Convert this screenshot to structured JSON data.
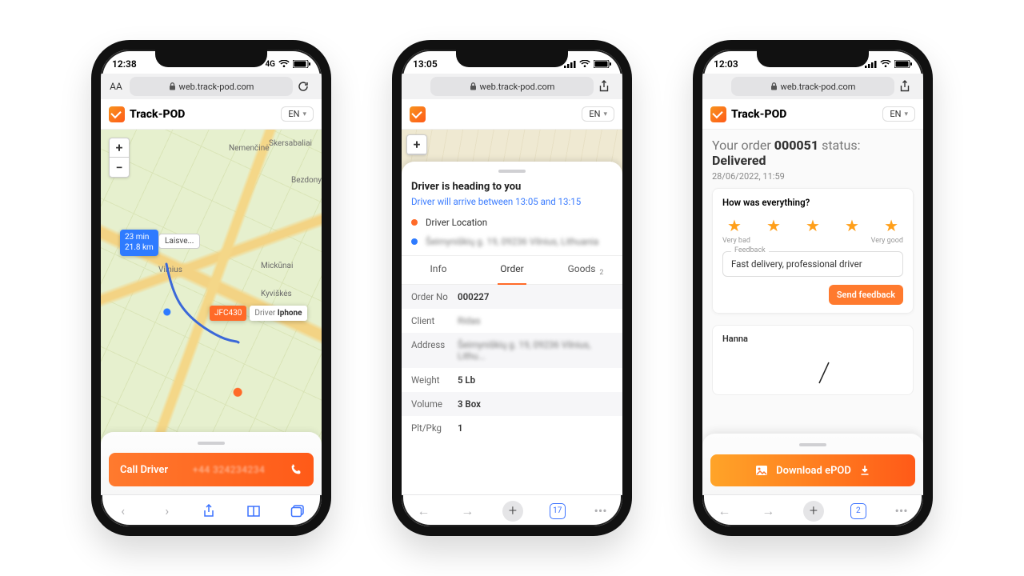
{
  "common": {
    "brand": "Track-POD",
    "url": "web.track-pod.com",
    "language": "EN"
  },
  "phone1": {
    "time": "12:38",
    "network": "4G",
    "addr_left": "AA",
    "eta_time": "23 min",
    "eta_dist": "21.8 km",
    "dest_short": "Laisve...",
    "city_a": "Vilnius",
    "city_b": "Nemenčinė",
    "city_c": "Mickūnai",
    "city_d": "Kyviškės",
    "city_e": "Skersabaliai",
    "city_f": "Bezdonys",
    "driver_code": "JFC430",
    "driver_label": "Driver",
    "driver_name": "Iphone",
    "call_label": "Call Driver",
    "call_number": "+44 324234234"
  },
  "phone2": {
    "time": "13:05",
    "tab_count": "17",
    "heading": "Driver is heading to you",
    "eta_line": "Driver will arrive between 13:05 and 13:15",
    "legend_driver": "Driver Location",
    "legend_dest": "Šeimyniškių g. 19, 09236 Vilnius, Lithuania",
    "tabs": {
      "info": "Info",
      "order": "Order",
      "goods": "Goods",
      "goods_count": "2"
    },
    "rows": [
      {
        "k": "Order No",
        "v": "000227"
      },
      {
        "k": "Client",
        "v": "Ridas"
      },
      {
        "k": "Address",
        "v": "Šeimyniškių g. 19, 09236 Vilnius, Lithu..."
      },
      {
        "k": "Weight",
        "v": "5 Lb"
      },
      {
        "k": "Volume",
        "v": "3 Box"
      },
      {
        "k": "Plt/Pkg",
        "v": "1"
      }
    ]
  },
  "phone3": {
    "time": "12:03",
    "tab_count": "2",
    "status_prefix": "Your order ",
    "order_no": "000051",
    "status_suffix": " status:",
    "status_value": "Delivered",
    "timestamp": "28/06/2022, 11:59",
    "rate_q": "How was everything?",
    "rate_low": "Very bad",
    "rate_high": "Very good",
    "fb_legend": "Feedback",
    "fb_text": "Fast delivery, professional driver",
    "send_label": "Send feedback",
    "signer": "Hanna",
    "download_label": "Download ePOD"
  }
}
